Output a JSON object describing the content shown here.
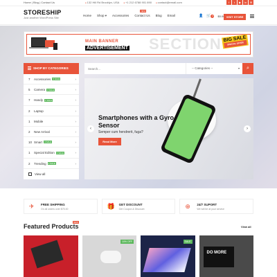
{
  "topbar": {
    "links": [
      "Home",
      "Blog",
      "Contact Us"
    ],
    "address": "132 Hill Rd Brooklyn, USA",
    "phone": "+1 212 6788 901 890",
    "email": "contact@email.com",
    "social": [
      "f",
      "t",
      "▶",
      "in",
      "✉"
    ]
  },
  "header": {
    "logo": "STORESHIP",
    "tagline": "Just another WordPress Site",
    "nav": [
      {
        "label": "Home",
        "badge": ""
      },
      {
        "label": "Shop ▾",
        "badge": ""
      },
      {
        "label": "Accessories",
        "badge": ""
      },
      {
        "label": "Contact Us",
        "badge": "NEW"
      },
      {
        "label": "Blog",
        "badge": ""
      },
      {
        "label": "Email",
        "badge": ""
      }
    ],
    "cart_count": "0",
    "cart_total": "$0.00",
    "visit_store": "VISIT STORE"
  },
  "banner": {
    "main": "MAIN BANNER",
    "advertisement": "ADVERTISEMENT",
    "section": "SECTION",
    "big_sale": "BIG SALE",
    "special_offer": "SPECIAL OFFER"
  },
  "sidebar": {
    "heading": "SHOP BY CATEGORIES",
    "items": [
      {
        "num": "7",
        "label": "Accessories",
        "tag": "5 SALE"
      },
      {
        "num": "5",
        "label": "Camera",
        "tag": "3 SALE"
      },
      {
        "num": "7",
        "label": "Handy",
        "tag": "1 SALE"
      },
      {
        "num": "2",
        "label": "Laptop",
        "tag": ""
      },
      {
        "num": "1",
        "label": "Mobile",
        "tag": ""
      },
      {
        "num": "2",
        "label": "New Arrival",
        "tag": ""
      },
      {
        "num": "10",
        "label": "Smart",
        "tag": "4 SALE"
      },
      {
        "num": "1",
        "label": "Special Edition",
        "tag": "1 SALE"
      },
      {
        "num": "2",
        "label": "Trending",
        "tag": "2 SALE"
      }
    ],
    "view_all": "View all"
  },
  "search": {
    "placeholder": "Search...",
    "category": "-- Categories --"
  },
  "slider": {
    "title": "Smartphones with a Gyro Sensor",
    "subtitle": "Semper cum hendrerit, fuga?",
    "button": "Read More"
  },
  "features": [
    {
      "icon": "✈",
      "title": "FREE SHIPPING",
      "sub": "On all orders over $75.00"
    },
    {
      "icon": "🎁",
      "title": "GET DISCOUNT",
      "sub": "Get Coupon & Discount"
    },
    {
      "icon": "⊕",
      "title": "24/7 SUPORT",
      "sub": "We will be at your service"
    }
  ],
  "featured": {
    "title": "Featured Products",
    "badge": "NEW",
    "view_all": "View all",
    "products": [
      {
        "badge": ""
      },
      {
        "badge": "10% OFF"
      },
      {
        "badge": "SALE"
      },
      {
        "badge": ""
      }
    ],
    "monitor_text": "DO MORE"
  },
  "colors": {
    "accent": "#e8543a",
    "sale_tag": "#5cb85c"
  }
}
